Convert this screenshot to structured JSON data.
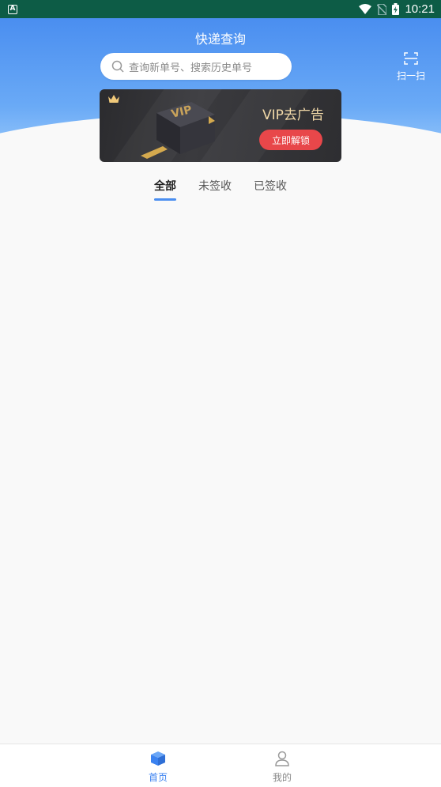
{
  "status_bar": {
    "time": "10:21",
    "icons": [
      "notification-a-icon",
      "wifi-icon",
      "no-sim-icon",
      "battery-icon"
    ]
  },
  "header": {
    "title": "快递查询",
    "search_placeholder": "查询新单号、搜索历史单号",
    "scan_label": "扫一扫"
  },
  "banner": {
    "headline": "VIP去广告",
    "button_label": "立即解锁",
    "box_text": "VIP"
  },
  "tabs": [
    {
      "label": "全部",
      "active": true
    },
    {
      "label": "未签收",
      "active": false
    },
    {
      "label": "已签收",
      "active": false
    }
  ],
  "bottom_nav": [
    {
      "label": "首页",
      "icon": "package-icon",
      "active": true
    },
    {
      "label": "我的",
      "icon": "person-icon",
      "active": false
    }
  ],
  "colors": {
    "accent": "#4a8ef0",
    "status_bar": "#0d5c46",
    "unlock_button": "#e8474a",
    "vip_gold": "#f2d9a8"
  }
}
